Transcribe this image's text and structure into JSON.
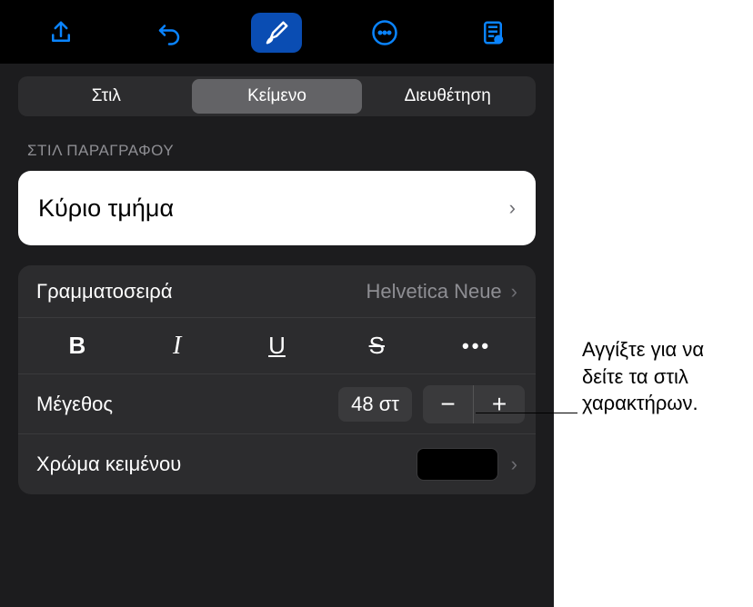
{
  "toolbar": {
    "icons": [
      "share",
      "undo",
      "brush",
      "more",
      "document-view"
    ]
  },
  "tabs": {
    "items": [
      "Στιλ",
      "Κείμενο",
      "Διευθέτηση"
    ],
    "activeIndex": 1
  },
  "paragraphStyle": {
    "sectionLabel": "ΣΤΙΛ ΠΑΡΑΓΡΑΦΟΥ",
    "value": "Κύριο τμήμα"
  },
  "font": {
    "label": "Γραμματοσειρά",
    "value": "Helvetica Neue",
    "styles": {
      "bold": "B",
      "italic": "I",
      "underline": "U",
      "strike": "S",
      "more": "•••"
    }
  },
  "size": {
    "label": "Μέγεθος",
    "value": "48 στ"
  },
  "textColor": {
    "label": "Χρώμα κειμένου",
    "value": "#000000"
  },
  "callout": {
    "text": "Αγγίξτε για να δείτε τα στιλ χαρακτήρων."
  }
}
